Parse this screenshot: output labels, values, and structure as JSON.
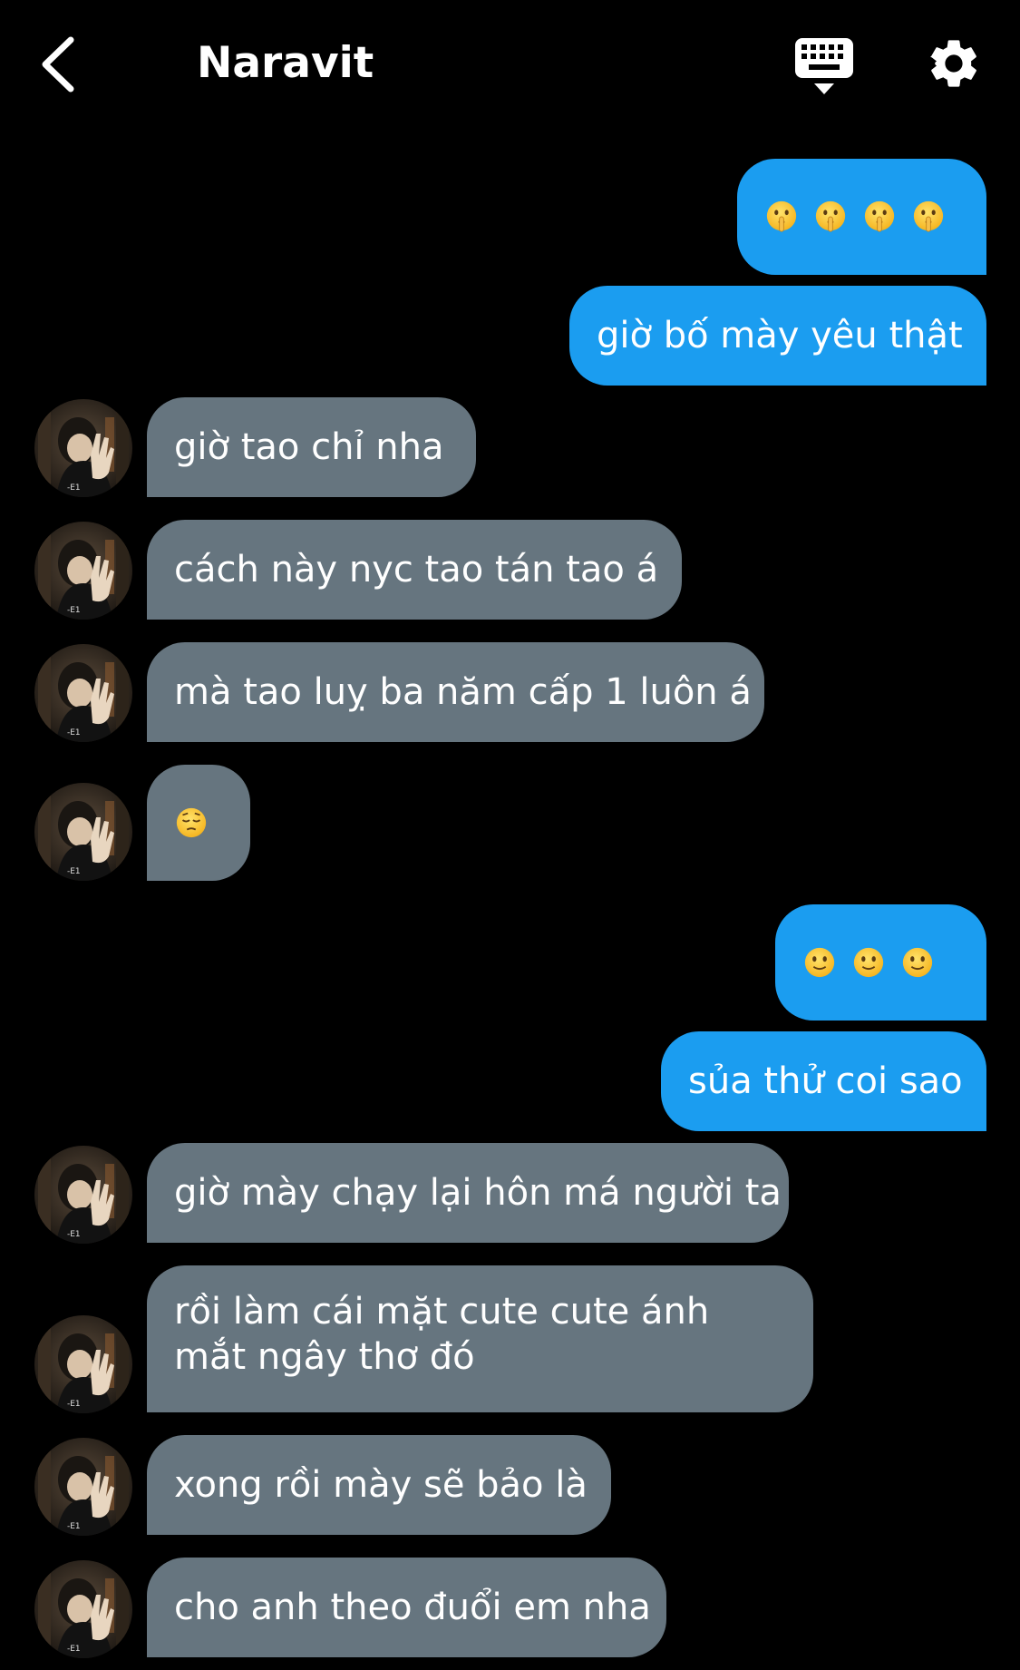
{
  "header": {
    "title": "Naravit",
    "back_icon": "chevron-left-icon",
    "keyboard_icon": "keyboard-icon",
    "settings_icon": "gear-icon"
  },
  "colors": {
    "background": "#000000",
    "sent_bubble": "#1b9df0",
    "received_bubble": "#66757f",
    "text": "#ffffff"
  },
  "messages": [
    {
      "from": "me",
      "emoji": "shushing-face",
      "count": 4
    },
    {
      "from": "me",
      "text": "giờ bố mày yêu thật"
    },
    {
      "from": "them",
      "text": "giờ tao chỉ nha"
    },
    {
      "from": "them",
      "text": "cách này nyc tao tán tao á"
    },
    {
      "from": "them",
      "text": "mà tao luỵ ba năm cấp 1 luôn á"
    },
    {
      "from": "them",
      "emoji": "pensive-face",
      "count": 1
    },
    {
      "from": "me",
      "emoji": "slightly-smiling-face",
      "count": 3
    },
    {
      "from": "me",
      "text": "sủa thử coi sao"
    },
    {
      "from": "them",
      "text": "giờ mày chạy lại hôn má người ta"
    },
    {
      "from": "them",
      "text": "rồi làm cái mặt cute cute ánh mắt ngây thơ đó"
    },
    {
      "from": "them",
      "text": "xong rồi mày sẽ bảo là"
    },
    {
      "from": "them",
      "text": "cho anh theo đuổi em nha"
    }
  ]
}
